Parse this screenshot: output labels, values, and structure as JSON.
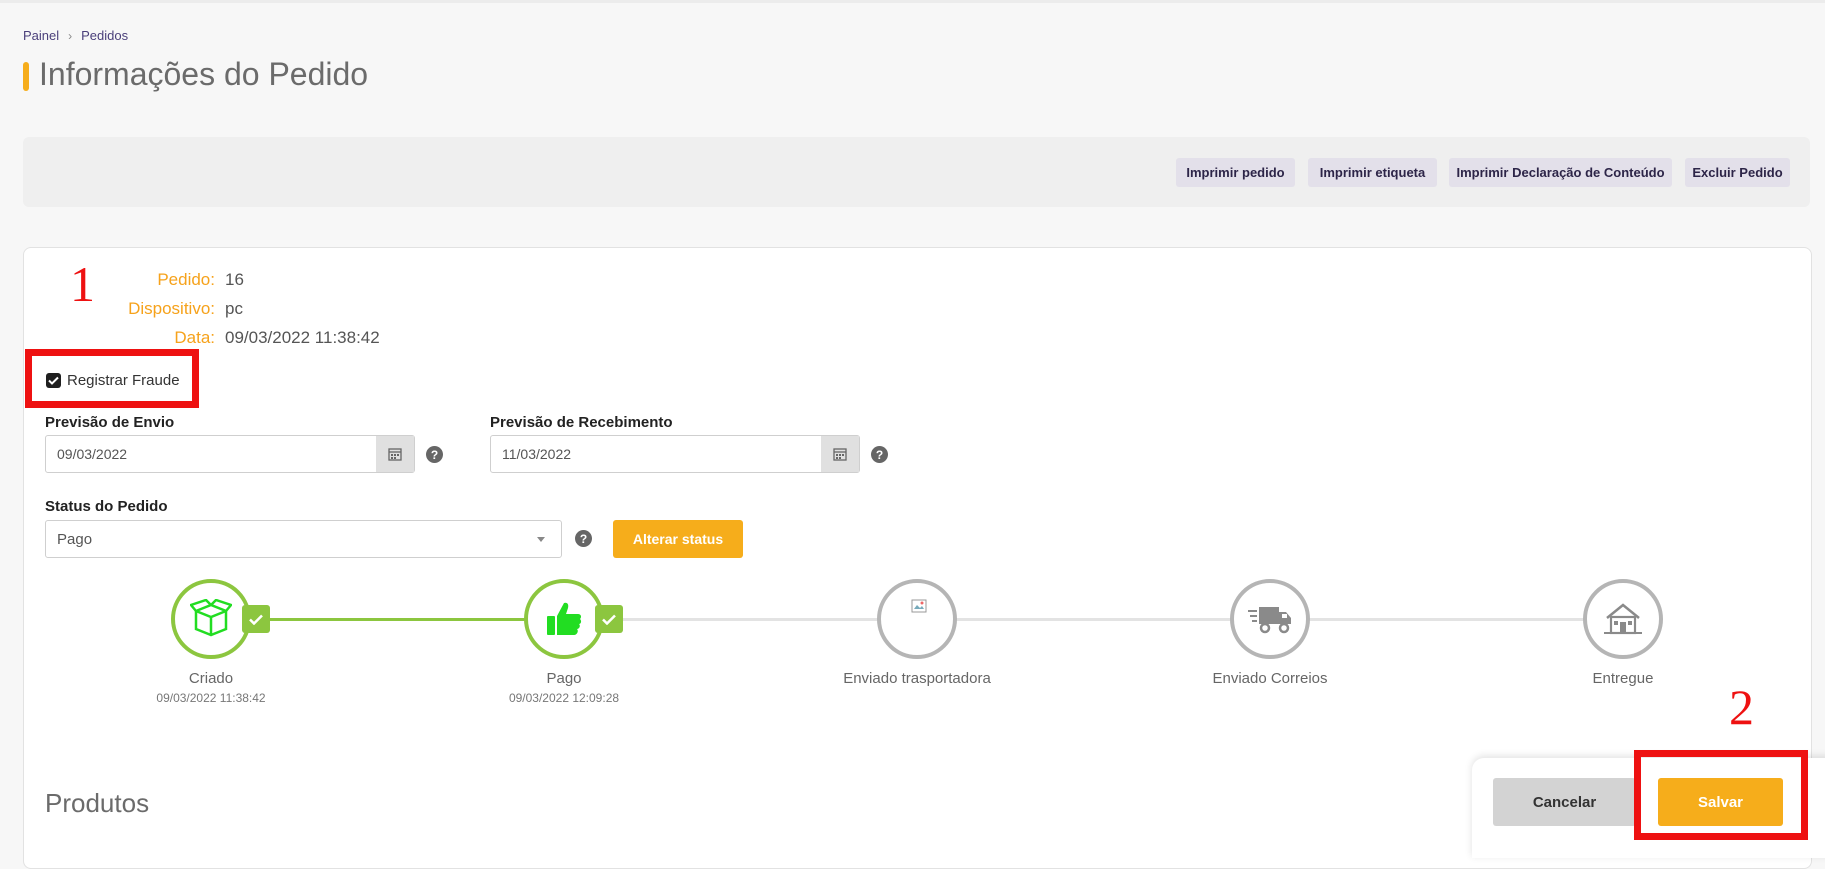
{
  "breadcrumb": {
    "items": [
      "Painel",
      "Pedidos"
    ]
  },
  "page_title": "Informações do Pedido",
  "actions": [
    {
      "label": "Imprimir pedido"
    },
    {
      "label": "Imprimir etiqueta"
    },
    {
      "label": "Imprimir Declaração de Conteúdo"
    },
    {
      "label": "Excluir Pedido"
    }
  ],
  "order": {
    "id_label": "Pedido:",
    "id_value": "16",
    "device_label": "Dispositivo:",
    "device_value": "pc",
    "date_label": "Data:",
    "date_value": "09/03/2022 11:38:42"
  },
  "fraud": {
    "label": "Registrar Fraude",
    "checked": true
  },
  "shipping": {
    "label": "Previsão de Envio",
    "value": "09/03/2022"
  },
  "receiving": {
    "label": "Previsão de Recebimento",
    "value": "11/03/2022"
  },
  "status": {
    "label": "Status do Pedido",
    "value": "Pago",
    "button": "Alterar status"
  },
  "steps": [
    {
      "name": "Criado",
      "date": "09/03/2022 11:38:42",
      "done": true,
      "icon": "box-icon"
    },
    {
      "name": "Pago",
      "date": "09/03/2022 12:09:28",
      "done": true,
      "icon": "thumbs-up-icon"
    },
    {
      "name": "Enviado trasportadora",
      "date": "",
      "done": false,
      "icon": "broken-image-icon"
    },
    {
      "name": "Enviado Correios",
      "date": "",
      "done": false,
      "icon": "delivery-truck-icon"
    },
    {
      "name": "Entregue",
      "date": "",
      "done": false,
      "icon": "house-icon"
    }
  ],
  "products_heading": "Produtos",
  "footer": {
    "cancel": "Cancelar",
    "save": "Salvar"
  },
  "annotations": [
    "1",
    "2"
  ],
  "colors": {
    "accent": "#f6ad1b",
    "done": "#8cc63f",
    "pending": "#b5b5b5",
    "annotation": "#ee1111",
    "bright_green": "#22dd22"
  }
}
